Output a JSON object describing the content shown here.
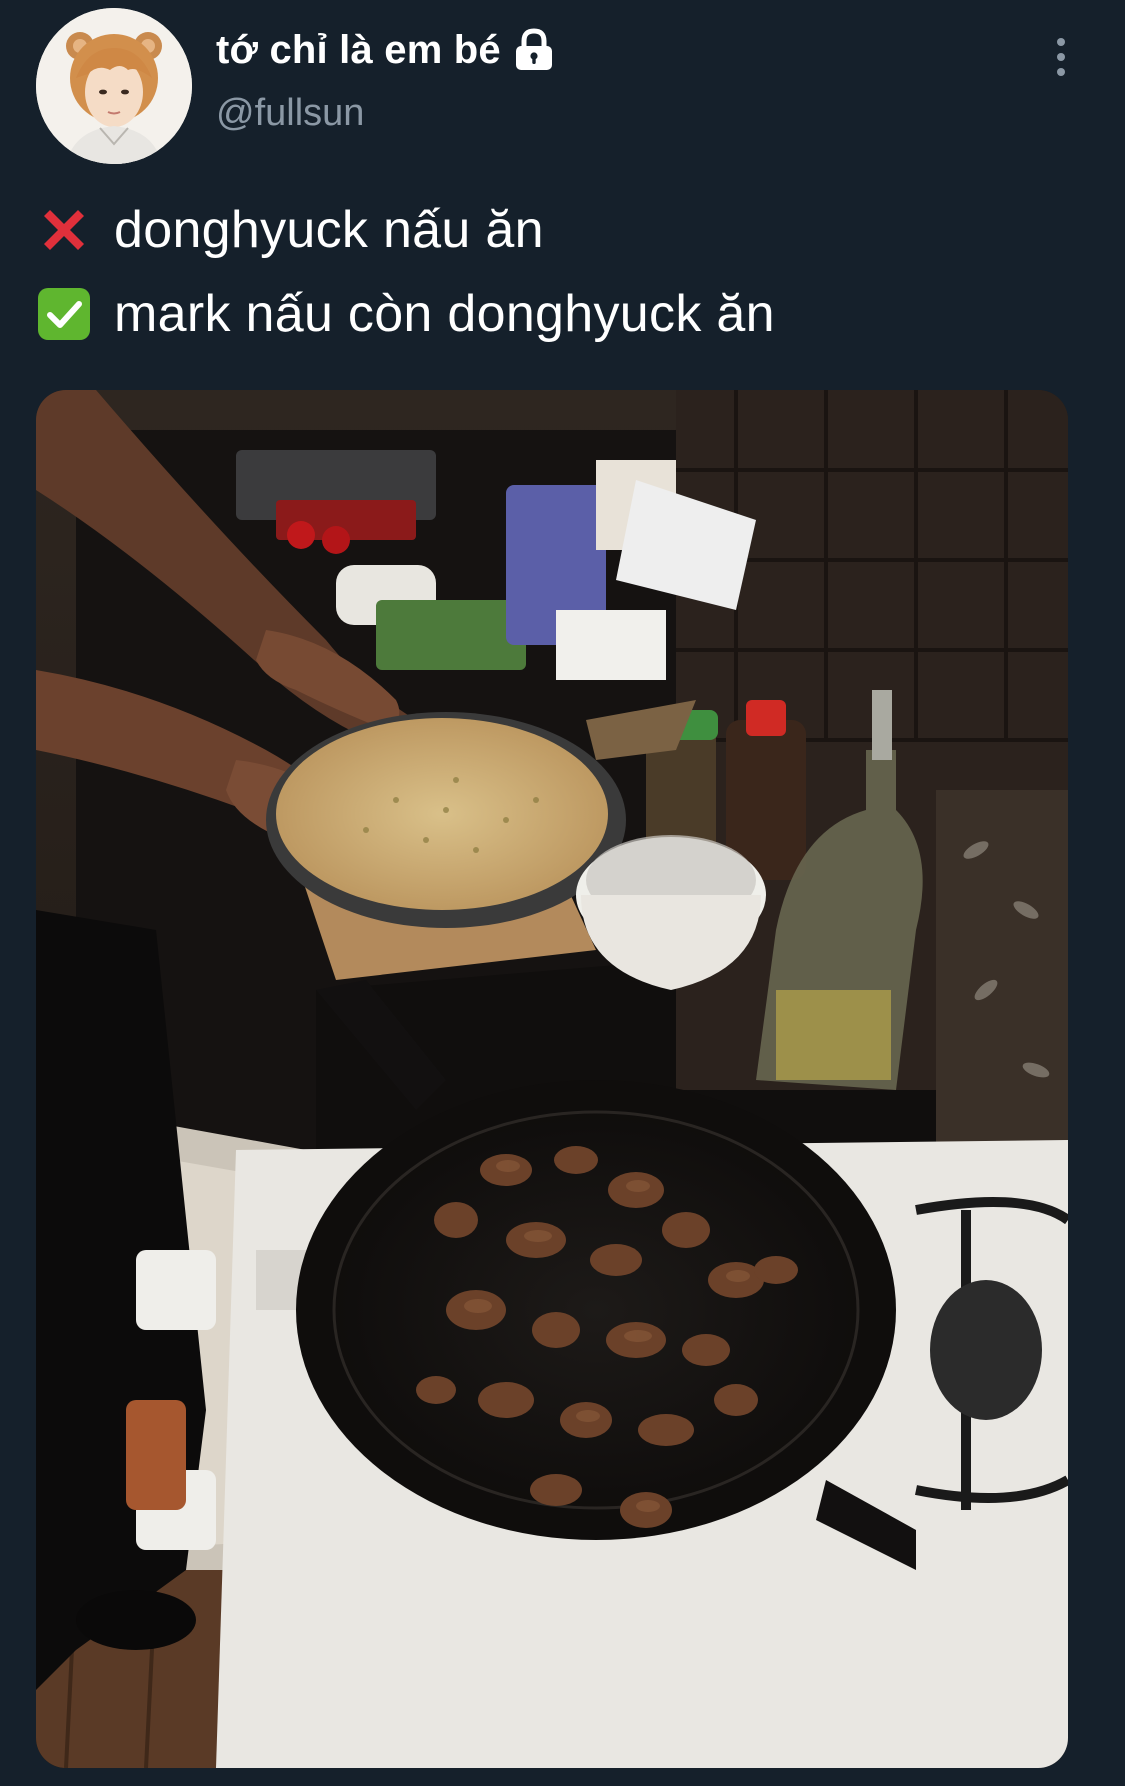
{
  "author": {
    "display_name": "tớ chỉ là em bé",
    "handle": "@fullsun",
    "avatar_icon": "avatar-photo",
    "protected_icon": "lock-icon"
  },
  "more_icon": "more-options-icon",
  "tweet": {
    "lines": [
      {
        "icon": "cross-mark-emoji",
        "text": "donghyuck nấu ăn"
      },
      {
        "icon": "check-mark-emoji",
        "text": "mark nấu còn donghyuck ăn"
      }
    ]
  },
  "media": {
    "type": "photo",
    "icon": "kitchen-photo"
  },
  "colors": {
    "background": "#15202b",
    "primary_text": "#ffffff",
    "secondary_text": "#8b98a5",
    "cross_red": "#e0303b",
    "check_green": "#5fb62f"
  }
}
